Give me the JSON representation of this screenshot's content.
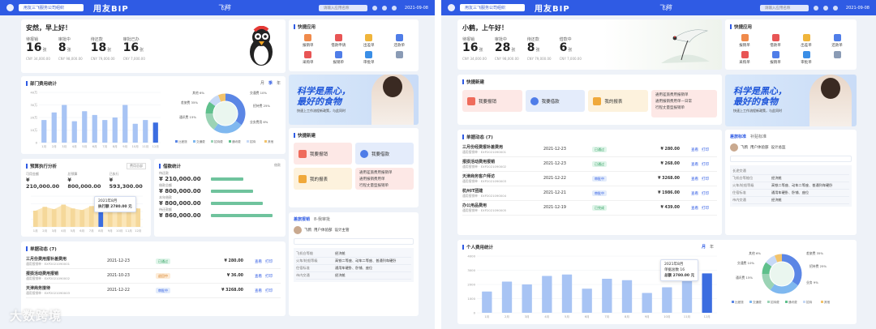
{
  "left": {
    "org": "用友三飞服务公司组织",
    "brand": "用友BIP",
    "app": "飞鸦",
    "search": "请输入应用名称",
    "date": "2021-09-08",
    "greeting": "安然，早上好！",
    "kpis": [
      {
        "label": "待报销",
        "value": "16",
        "unit": "张",
        "sub": "CNY 34,000.00"
      },
      {
        "label": "审批中",
        "value": "8",
        "unit": "张",
        "sub": "CNY 98,000.00"
      },
      {
        "label": "待还款",
        "value": "18",
        "unit": "张",
        "sub": "CNY 79,000.00"
      },
      {
        "label": "审批已办",
        "value": "16",
        "unit": "张",
        "sub": "CNY 7,000.00"
      }
    ],
    "quick_title": "快捷应用",
    "quick": [
      "报销单",
      "借款申请",
      "出差单",
      "还款单",
      "采购单",
      "报销单",
      "审批单",
      ""
    ],
    "dept_title": "部门费用统计",
    "dept_tabs": [
      "月",
      "季",
      "年"
    ],
    "dept_y": [
      "40万",
      "30万",
      "20万",
      "10万",
      "0"
    ],
    "dept_x": [
      "1月",
      "2月",
      "3月",
      "4月",
      "5月",
      "6月",
      "7月",
      "8月",
      "9月",
      "10月",
      "11月",
      "12月"
    ],
    "pie_labels": [
      "其他 6%",
      "差旅费 35%",
      "通讯费 15%",
      "交通费 10%",
      "招待费 25%",
      "业务费用 6%"
    ],
    "legend": [
      "比差旅",
      "交通费",
      "招待费",
      "通讯费",
      "招待",
      "其他"
    ],
    "banner_title": "科学是黑心，最好的食物",
    "banner_sub": "快速上工作流程新政策，与此同时",
    "quick2_title": "快捷新建",
    "qbtns": [
      "我要报销",
      "我要借款",
      "我的报表"
    ],
    "qlist": [
      "通用差旅费用报销单",
      "通用报销费用单",
      "行程丈量型报销单"
    ],
    "budget_title": "预算执行分析",
    "budget_select": "费用总部",
    "budget_kpis": [
      {
        "label": "可用金额",
        "value": "¥ 210,000.00"
      },
      {
        "label": "总预算",
        "value": "¥ 800,000.00"
      },
      {
        "label": "已执行",
        "value": "¥ 593,300.00"
      }
    ],
    "budget_tip": [
      "2021年8月",
      "执行额 2780.00 元"
    ],
    "stat_title": "借款统计",
    "stat_tabs": [
      "借款"
    ],
    "stat_items": [
      {
        "label": "待还款",
        "value": "¥ 210,000.00"
      },
      {
        "label": "借款总额",
        "value": "¥ 800,000.00"
      },
      {
        "label": "本年借款",
        "value": "¥ 800,000.00"
      },
      {
        "label": "待还款额",
        "value": "¥ 860,000.00"
      }
    ],
    "docs_title": "单据动态 (7)",
    "docs": [
      {
        "name": "三月份费用报补差费用",
        "code": "通用报销单 · EXP2021090001",
        "date": "2021-12-23",
        "status": "已通过",
        "amount": "¥ 280.00"
      },
      {
        "name": "报损活动费用报销",
        "code": "通用报销单 · EXP2021090002",
        "date": "2021-10-23",
        "status": "退回中",
        "amount": "¥ 36.00"
      },
      {
        "name": "天津商务接待",
        "code": "通用报销单 · EXP2021090003",
        "date": "2021-12-22",
        "status": "审批中",
        "amount": "¥ 3268.00"
      }
    ],
    "doc_links": [
      "查看",
      "打印"
    ],
    "approve_title": "差旅报销",
    "approve_tab2": "8-我审批",
    "approve_user": "飞鸦",
    "approve_dept": "用户体验部",
    "approve_role": "设计主管",
    "approve_rows": [
      {
        "k": "飞机仓等舱",
        "v": "经济舱"
      },
      {
        "k": "火车/轮船等级",
        "v": "高铁二等座、动车二等座、普通列车硬卧"
      },
      {
        "k": "住宿标准",
        "v": "通用车硬卧、卧铺、座位"
      },
      {
        "k": "市内交通",
        "v": "经济舱"
      }
    ]
  },
  "right": {
    "greeting": "小鹤，上午好！",
    "kpis": [
      {
        "label": "待报销",
        "value": "16",
        "unit": "张",
        "sub": "CNY 34,000.00"
      },
      {
        "label": "审批中",
        "value": "28",
        "unit": "张",
        "sub": "CNY 98,000.00"
      },
      {
        "label": "待还款",
        "value": "8",
        "unit": "张",
        "sub": "CNY 79,000.00"
      },
      {
        "label": "借款中",
        "value": "6",
        "unit": "张",
        "sub": "CNY 7,000.00"
      }
    ],
    "quick_title": "快捷应用",
    "quick": [
      "报销单",
      "借款单",
      "出差单",
      "还款单",
      "采购单",
      "报销单",
      "审批单",
      ""
    ],
    "qnew_title": "快捷新建",
    "qbtns": [
      "我要报销",
      "我要借款",
      "我的报表"
    ],
    "qlist": [
      "通用差旅费用报销单",
      "通用报销费用单—日常",
      "行程丈量型报销单"
    ],
    "docs_title": "单据动态 (7)",
    "docs": [
      {
        "name": "三月份经费报补差费用",
        "code": "通用报销单 · EXP2021090001",
        "date": "2021-12-23",
        "status": "已通过",
        "amount": "¥ 280.00"
      },
      {
        "name": "报损活动费用报销",
        "code": "通用报销单 · EXP2021090002",
        "date": "2021-12-23",
        "status": "已通过",
        "amount": "¥ 268.00"
      },
      {
        "name": "天津商务客户拜访",
        "code": "通用报销单 · EXP2021090003",
        "date": "2021-12-22",
        "status": "审批中",
        "amount": "¥ 3268.00"
      },
      {
        "name": "杭州IT团建",
        "code": "通用报销单 · EXP2021090004",
        "date": "2021-12-21",
        "status": "审批中",
        "amount": "¥ 1986.00"
      },
      {
        "name": "办公用品费用",
        "code": "通用报销单 · EXP2021090005",
        "date": "2021-12-19",
        "status": "已完成",
        "amount": "¥ 439.00"
      }
    ],
    "doc_links": [
      "查看",
      "打印"
    ],
    "approve_title": "差旅标准",
    "approve_tab2": "补贴标准",
    "approve_user": "飞鸦",
    "approve_dept": "用户体验部",
    "approve_role": "设计总监",
    "approve_rows": [
      {
        "k": "长途交通",
        "v": ""
      },
      {
        "k": "飞机仓等舱位",
        "v": "经济舱"
      },
      {
        "k": "火车/轮船等级",
        "v": "高铁二等座、动车二等座、普通列车硬卧"
      },
      {
        "k": "住宿标准",
        "v": "通用车硬卧、卧铺、座位"
      },
      {
        "k": "市内交通",
        "v": "经济舱"
      }
    ],
    "personal_title": "个人费用统计",
    "personal_tabs": [
      "月",
      "年"
    ],
    "personal_x": [
      "1月",
      "2月",
      "3月",
      "4月",
      "5月",
      "6月",
      "7月",
      "8月",
      "9月",
      "10月",
      "11月",
      "12月"
    ],
    "personal_y": [
      "4000",
      "3000",
      "2000",
      "1000",
      "0"
    ],
    "personal_tip": [
      "2021年8月",
      "单据总数 16",
      "总额 2780.00 元"
    ],
    "pie_labels": [
      "其他 6%",
      "交通费 10%",
      "通讯费 15%",
      "差旅费 35%",
      "招待费 25%",
      "业务 9%"
    ],
    "legend": [
      "比差旅",
      "交通费",
      "招待费",
      "通讯费",
      "招待",
      "其他"
    ]
  },
  "watermark": "大数跨境",
  "colors": {
    "primary": "#2f5be4",
    "bar": "#a8c4f4",
    "bar_active": "#3b6de0",
    "area": "#f5d89a"
  },
  "chart_data": [
    {
      "type": "bar",
      "title": "部门费用统计",
      "categories": [
        "1月",
        "2月",
        "3月",
        "4月",
        "5月",
        "6月",
        "7月",
        "8月",
        "9月",
        "10月",
        "11月",
        "12月"
      ],
      "values": [
        180000,
        240000,
        300000,
        170000,
        250000,
        220000,
        180000,
        200000,
        300000,
        150000,
        180000,
        160000
      ],
      "ylim": [
        0,
        400000
      ]
    },
    {
      "type": "bar",
      "title": "预算执行分析",
      "categories": [
        "1月",
        "2月",
        "3月",
        "4月",
        "5月",
        "6月",
        "7月",
        "8月",
        "9月",
        "10月",
        "11月",
        "12月"
      ],
      "values": [
        2100,
        2600,
        2300,
        2900,
        2400,
        2200,
        2700,
        2780,
        2500,
        2300,
        2600,
        2400
      ],
      "ylim": [
        0,
        4000
      ]
    },
    {
      "type": "bar",
      "title": "个人费用统计",
      "categories": [
        "1月",
        "2月",
        "3月",
        "4月",
        "5月",
        "6月",
        "7月",
        "8月",
        "9月",
        "10月",
        "11月",
        "12月"
      ],
      "values": [
        1500,
        2200,
        2000,
        2600,
        2700,
        1700,
        2400,
        2300,
        1400,
        1800,
        2400,
        2780
      ],
      "ylim": [
        0,
        4000
      ]
    },
    {
      "type": "pie",
      "title": "费用类型",
      "categories": [
        "差旅费",
        "招待费",
        "通讯费",
        "交通费",
        "业务",
        "其他"
      ],
      "values": [
        35,
        25,
        15,
        10,
        9,
        6
      ]
    }
  ]
}
